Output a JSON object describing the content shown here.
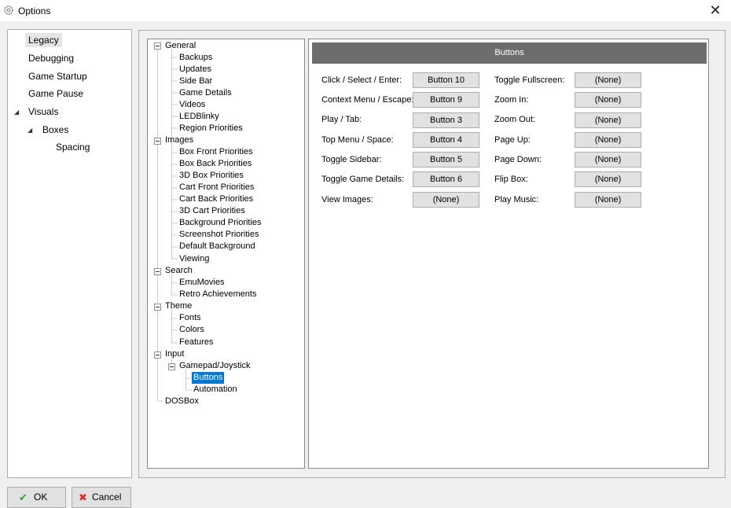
{
  "window": {
    "title": "Options",
    "close_glyph": "✕"
  },
  "left_nav": [
    {
      "label": "Legacy",
      "selected": true
    },
    {
      "label": "Debugging"
    },
    {
      "label": "Game Startup"
    },
    {
      "label": "Game Pause"
    },
    {
      "label": "Visuals"
    },
    {
      "label": "Boxes"
    },
    {
      "label": "Spacing"
    }
  ],
  "tree": [
    {
      "label": "General"
    },
    {
      "label": "Backups"
    },
    {
      "label": "Updates"
    },
    {
      "label": "Side Bar"
    },
    {
      "label": "Game Details"
    },
    {
      "label": "Videos"
    },
    {
      "label": "LEDBlinky"
    },
    {
      "label": "Region Priorities"
    },
    {
      "label": "Images"
    },
    {
      "label": "Box Front Priorities"
    },
    {
      "label": "Box Back Priorities"
    },
    {
      "label": "3D Box Priorities"
    },
    {
      "label": "Cart Front Priorities"
    },
    {
      "label": "Cart Back Priorities"
    },
    {
      "label": "3D Cart Priorities"
    },
    {
      "label": "Background Priorities"
    },
    {
      "label": "Screenshot Priorities"
    },
    {
      "label": "Default Background"
    },
    {
      "label": "Viewing"
    },
    {
      "label": "Search"
    },
    {
      "label": "EmuMovies"
    },
    {
      "label": "Retro Achievements"
    },
    {
      "label": "Theme"
    },
    {
      "label": "Fonts"
    },
    {
      "label": "Colors"
    },
    {
      "label": "Features"
    },
    {
      "label": "Input"
    },
    {
      "label": "Gamepad/Joystick"
    },
    {
      "label": "Buttons",
      "selected": true
    },
    {
      "label": "Automation"
    },
    {
      "label": "DOSBox"
    }
  ],
  "content": {
    "header": "Buttons",
    "left_column": [
      {
        "label": "Click / Select / Enter:",
        "value": "Button 10"
      },
      {
        "label": "Context Menu / Escape:",
        "value": "Button 9"
      },
      {
        "label": "Play / Tab:",
        "value": "Button 3"
      },
      {
        "label": "Top Menu / Space:",
        "value": "Button 4"
      },
      {
        "label": "Toggle Sidebar:",
        "value": "Button 5"
      },
      {
        "label": "Toggle Game Details:",
        "value": "Button 6"
      },
      {
        "label": "View Images:",
        "value": "(None)"
      }
    ],
    "right_column": [
      {
        "label": "Toggle Fullscreen:",
        "value": "(None)"
      },
      {
        "label": "Zoom In:",
        "value": "(None)"
      },
      {
        "label": "Zoom Out:",
        "value": "(None)"
      },
      {
        "label": "Page Up:",
        "value": "(None)"
      },
      {
        "label": "Page Down:",
        "value": "(None)"
      },
      {
        "label": "Flip Box:",
        "value": "(None)"
      },
      {
        "label": "Play Music:",
        "value": "(None)"
      }
    ]
  },
  "actions": {
    "ok_label": "OK",
    "cancel_label": "Cancel"
  },
  "colors": {
    "header_bg": "#6d6d6d",
    "selection": "#0078d7",
    "ok_icon": "#2e9e3a",
    "cancel_icon": "#d9302c"
  }
}
